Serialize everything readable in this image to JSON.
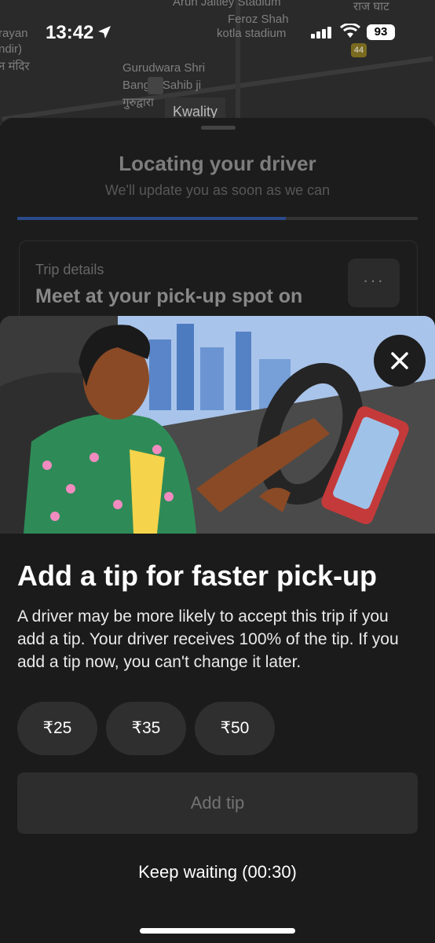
{
  "status_bar": {
    "time": "13:42",
    "battery": "93"
  },
  "map": {
    "labels": {
      "stadium": "Arun Jaitley Stadium",
      "feroz1": "Feroz Shah",
      "feroz2": "kotla stadium",
      "left1": "rayan",
      "left2": "ndir)",
      "left3": "न मंदिर",
      "gurudwara1": "Gurudwara Shri",
      "gurudwara2": "Bangla Sahib ji",
      "gurudwara3": "गुरुद्वारा",
      "raj_ghat": "राज घाट",
      "road_no": "44",
      "kwality": "Kwality"
    }
  },
  "locating": {
    "title": "Locating your driver",
    "subtitle": "We'll update you as soon as we can",
    "progress": 0.67
  },
  "trip_card": {
    "label": "Trip details",
    "main": "Meet at your pick-up spot on",
    "more": "···"
  },
  "tip_modal": {
    "title": "Add a tip for faster pick-up",
    "body": "A driver may be more likely to accept this trip if you add a tip. Your driver receives 100% of the tip. If you add a tip now, you can't change it later.",
    "options": [
      "₹25",
      "₹35",
      "₹50"
    ],
    "add_button": "Add tip",
    "keep_waiting": "Keep waiting (00:30)"
  }
}
